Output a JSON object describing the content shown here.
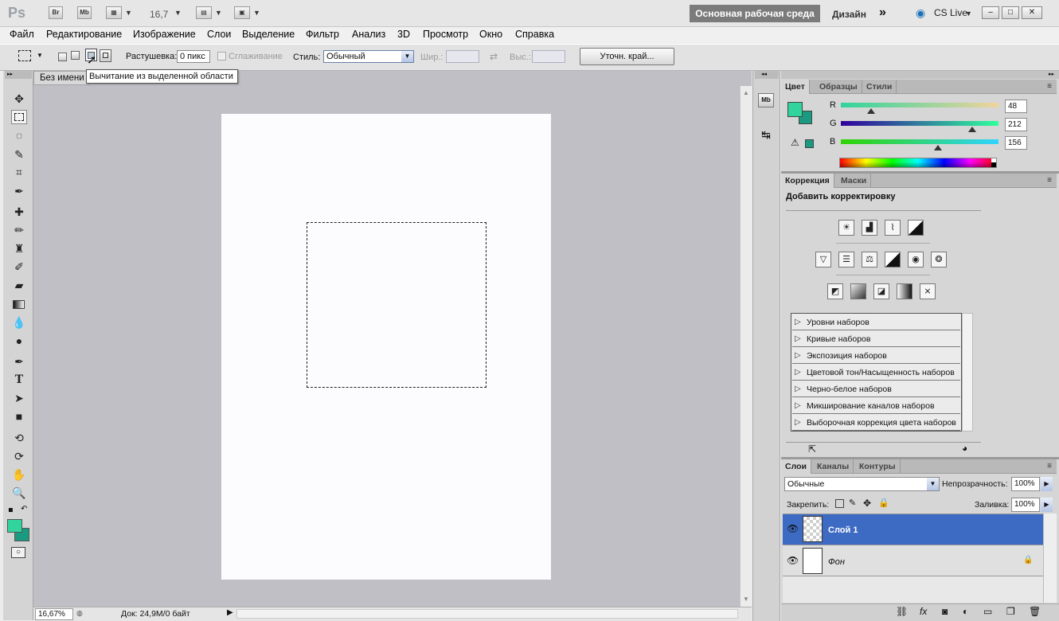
{
  "app": {
    "logo": "Ps",
    "bridge": "Br",
    "minibridge": "Mb",
    "zoom_value": "16,7",
    "workspace_active": "Основная рабочая среда",
    "workspace_design": "Дизайн",
    "more": "»",
    "cs_live": "CS Live"
  },
  "menu": [
    "Файл",
    "Редактирование",
    "Изображение",
    "Слои",
    "Выделение",
    "Фильтр",
    "Анализ",
    "3D",
    "Просмотр",
    "Окно",
    "Справка"
  ],
  "options": {
    "feather_label": "Растушевка:",
    "feather_value": "0 пикс",
    "antialias_label": "Сглаживание",
    "style_label": "Стиль:",
    "style_value": "Обычный",
    "width_label": "Шир.:",
    "height_label": "Выс.:",
    "refine_edge": "Уточн. край..."
  },
  "document": {
    "tab_title": "Без имени",
    "tooltip": "Вычитание из выделенной области",
    "zoom_status": "16,67%",
    "doc_status": "Док: 24,9M/0 байт"
  },
  "color_panel": {
    "tabs": [
      "Цвет",
      "Образцы",
      "Стили"
    ],
    "r_label": "R",
    "r_value": "48",
    "g_label": "G",
    "g_value": "212",
    "b_label": "B",
    "b_value": "156",
    "fg_color": "#30d49c",
    "bg_color": "#1a9a80"
  },
  "adjust_panel": {
    "tabs": [
      "Коррекция",
      "Маски"
    ],
    "heading": "Добавить корректировку",
    "presets": [
      "Уровни наборов",
      "Кривые наборов",
      "Экспозиция наборов",
      "Цветовой тон/Насыщенность наборов",
      "Черно-белое наборов",
      "Микширование каналов наборов",
      "Выборочная коррекция цвета наборов"
    ]
  },
  "layers_panel": {
    "tabs": [
      "Слои",
      "Каналы",
      "Контуры"
    ],
    "blend_mode": "Обычные",
    "opacity_label": "Непрозрачность:",
    "opacity_value": "100%",
    "lock_label": "Закрепить:",
    "fill_label": "Заливка:",
    "fill_value": "100%",
    "layers": [
      {
        "name": "Слой 1",
        "selected": true
      },
      {
        "name": "Фон",
        "selected": false
      }
    ]
  }
}
